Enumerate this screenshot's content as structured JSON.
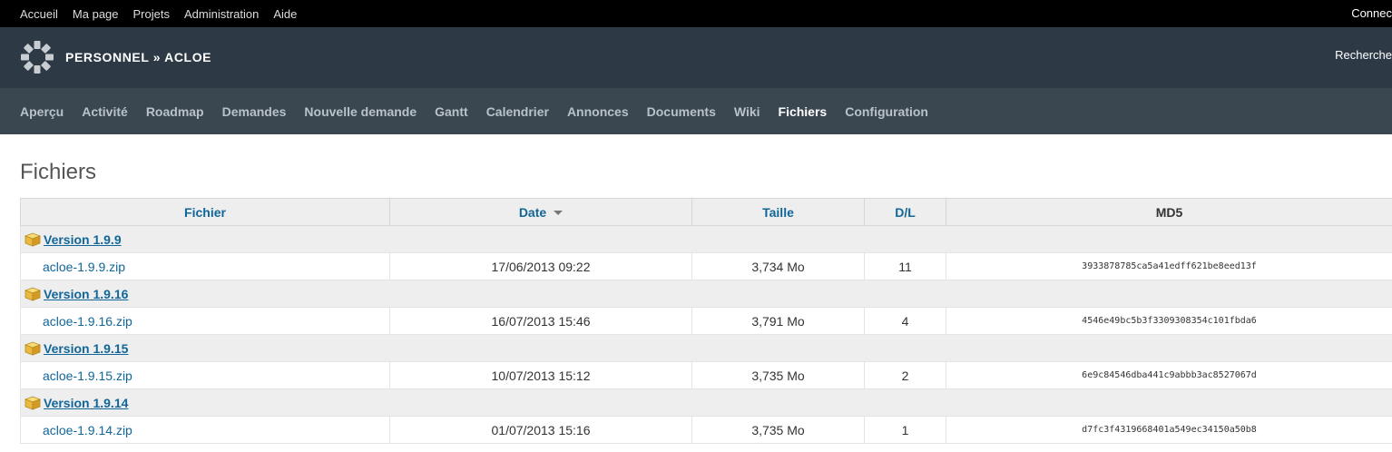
{
  "top_menu": [
    "Accueil",
    "Ma page",
    "Projets",
    "Administration",
    "Aide"
  ],
  "account_label": "Connec",
  "header": {
    "project_title": "PERSONNEL » ACLOE",
    "search_label": "Recherche"
  },
  "project_menu": {
    "items": [
      "Aperçu",
      "Activité",
      "Roadmap",
      "Demandes",
      "Nouvelle demande",
      "Gantt",
      "Calendrier",
      "Annonces",
      "Documents",
      "Wiki",
      "Fichiers",
      "Configuration"
    ],
    "selected": "Fichiers"
  },
  "page": {
    "title": "Fichiers"
  },
  "table": {
    "columns": {
      "file": "Fichier",
      "date": "Date",
      "size": "Taille",
      "downloads": "D/L",
      "md5": "MD5"
    },
    "groups": [
      {
        "version": "Version 1.9.9",
        "file": "acloe-1.9.9.zip",
        "date": "17/06/2013 09:22",
        "size": "3,734 Mo",
        "downloads": "11",
        "md5": "3933878785ca5a41edff621be8eed13f"
      },
      {
        "version": "Version 1.9.16",
        "file": "acloe-1.9.16.zip",
        "date": "16/07/2013 15:46",
        "size": "3,791 Mo",
        "downloads": "4",
        "md5": "4546e49bc5b3f3309308354c101fbda6"
      },
      {
        "version": "Version 1.9.15",
        "file": "acloe-1.9.15.zip",
        "date": "10/07/2013 15:12",
        "size": "3,735 Mo",
        "downloads": "2",
        "md5": "6e9c84546dba441c9abbb3ac8527067d"
      },
      {
        "version": "Version 1.9.14",
        "file": "acloe-1.9.14.zip",
        "date": "01/07/2013 15:16",
        "size": "3,735 Mo",
        "downloads": "1",
        "md5": "d7fc3f4319668401a549ec34150a50b8"
      }
    ]
  }
}
